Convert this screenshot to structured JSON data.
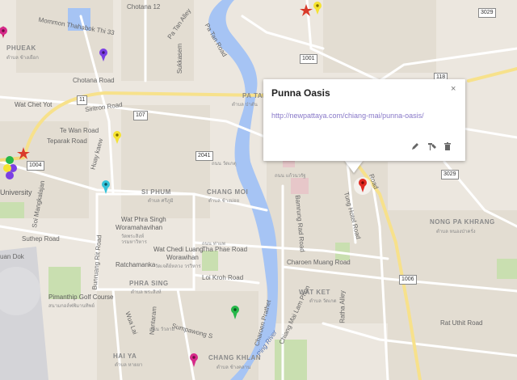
{
  "info_window": {
    "title": "Punna Oasis",
    "link": "http://newpattaya.com/chiang-mai/punna-oasis/",
    "close": "×"
  },
  "tools": [
    "pencil-icon",
    "style-icon",
    "trash-icon"
  ],
  "labels": {
    "pa_tan": "PA TAN",
    "si_phum": "SI PHUM",
    "chang_moi": "CHANG MOI",
    "phra_sing": "PHRA SING",
    "chang_khlan": "CHANG KHLAN",
    "hai_ya": "HAI YA",
    "wat_ket": "WAT KET",
    "nong_pa_khrang": "NONG PA KHRANG",
    "phueak": "PHUEAK",
    "wat_chet_yot": "Wat Chet Yot",
    "university": "University",
    "wat_phra_singh": "Wat Phra Singh",
    "woramahavihan": "Woramahavihan",
    "wat_chedi_luang": "Wat Chedi Luang",
    "worawihan": "Worawihan",
    "ratchamanka": "Ratchamanka",
    "pimanthip": "Pimanthip Golf Course",
    "suthep": "Suthep Road",
    "uan_dok": "uan Dok",
    "chotana12": "Chotana 12",
    "chotana": "Chotana Road",
    "mommon": "Mommon Thahabok Thi 33",
    "pa_tan_alley": "Pa Tan Alley",
    "pa_tan_rd": "Pa Tan Road",
    "sukkasem": "Sukkasem",
    "sirtron": "Siritron Road",
    "te_wan": "Te Wan Road",
    "teparak": "Teparak Road",
    "huay_kaew": "Huay kaew",
    "soi_mangkalajan": "Soi Mangkalajan",
    "bunruang": "Bunruang Rit Road",
    "tha_phae": "Tha Phae Road",
    "loi_kroh": "Loi Kroh Road",
    "wua_lai": "Wua Lai",
    "nantaram": "Nantaram",
    "sumpawong": "Sumpawong S",
    "charoen_muang": "Charoen Muang Road",
    "bamrung_rad": "Bamrung Rad Road",
    "tung_hotel": "Tung Hotel Road",
    "road_label": "Road",
    "ratha_alley": "Ratha Alley",
    "rat_uthit": "Rat Uthit Road",
    "chiang_mai_lam": "Chiang Mai Lam Phun",
    "charoen_prathet": "Charoen Prathet",
    "ping_river": "Ping River",
    "the_lam": "Road",
    "thai1": "ตำบล ป่าตัน",
    "thai2": "ถนน วัดเกตุ",
    "thai3": "ถนน แก้วนวรัฐ",
    "thai4": "ตำบล ช้างม่อย",
    "thai5": "ตำบล ศรีภูมิ",
    "thai6": "ถนน วัวลาย",
    "thai7": "ตำบล หนองป่าครั่ง",
    "thai8": "ตำบล วัดเกต",
    "thai9": "ตำบล พระสิงห์",
    "thai10": "ตำบล ช้างคลาน",
    "thai11": "ตำบล หายยา",
    "thai12": "วัดพระสิงห์",
    "thai13": "วรมหาวิหาร",
    "thai14": "วัดเจดีย์หลวง วรวิหาร",
    "thai15": "สนามกอล์ฟพิมานทิพย์",
    "thai16": "ตำบล ช้างเผือก",
    "thai17": "ถนน ท่าแพ",
    "thai18": "ถนน วัดเกตุ"
  },
  "shields": {
    "s1001": "1001",
    "s118": "118",
    "s11": "11",
    "s107": "107",
    "s2041": "2041",
    "s1004": "1004",
    "s3029a": "3029",
    "s3029b": "3029",
    "s1006": "1006"
  },
  "colors": {
    "land": "#ece7df",
    "block": "#e4ded4",
    "park": "#c9dfb0",
    "river": "#a6c4f4",
    "yellow_road": "#f7e18b",
    "road": "#ffffff",
    "link": "#8878c8"
  }
}
